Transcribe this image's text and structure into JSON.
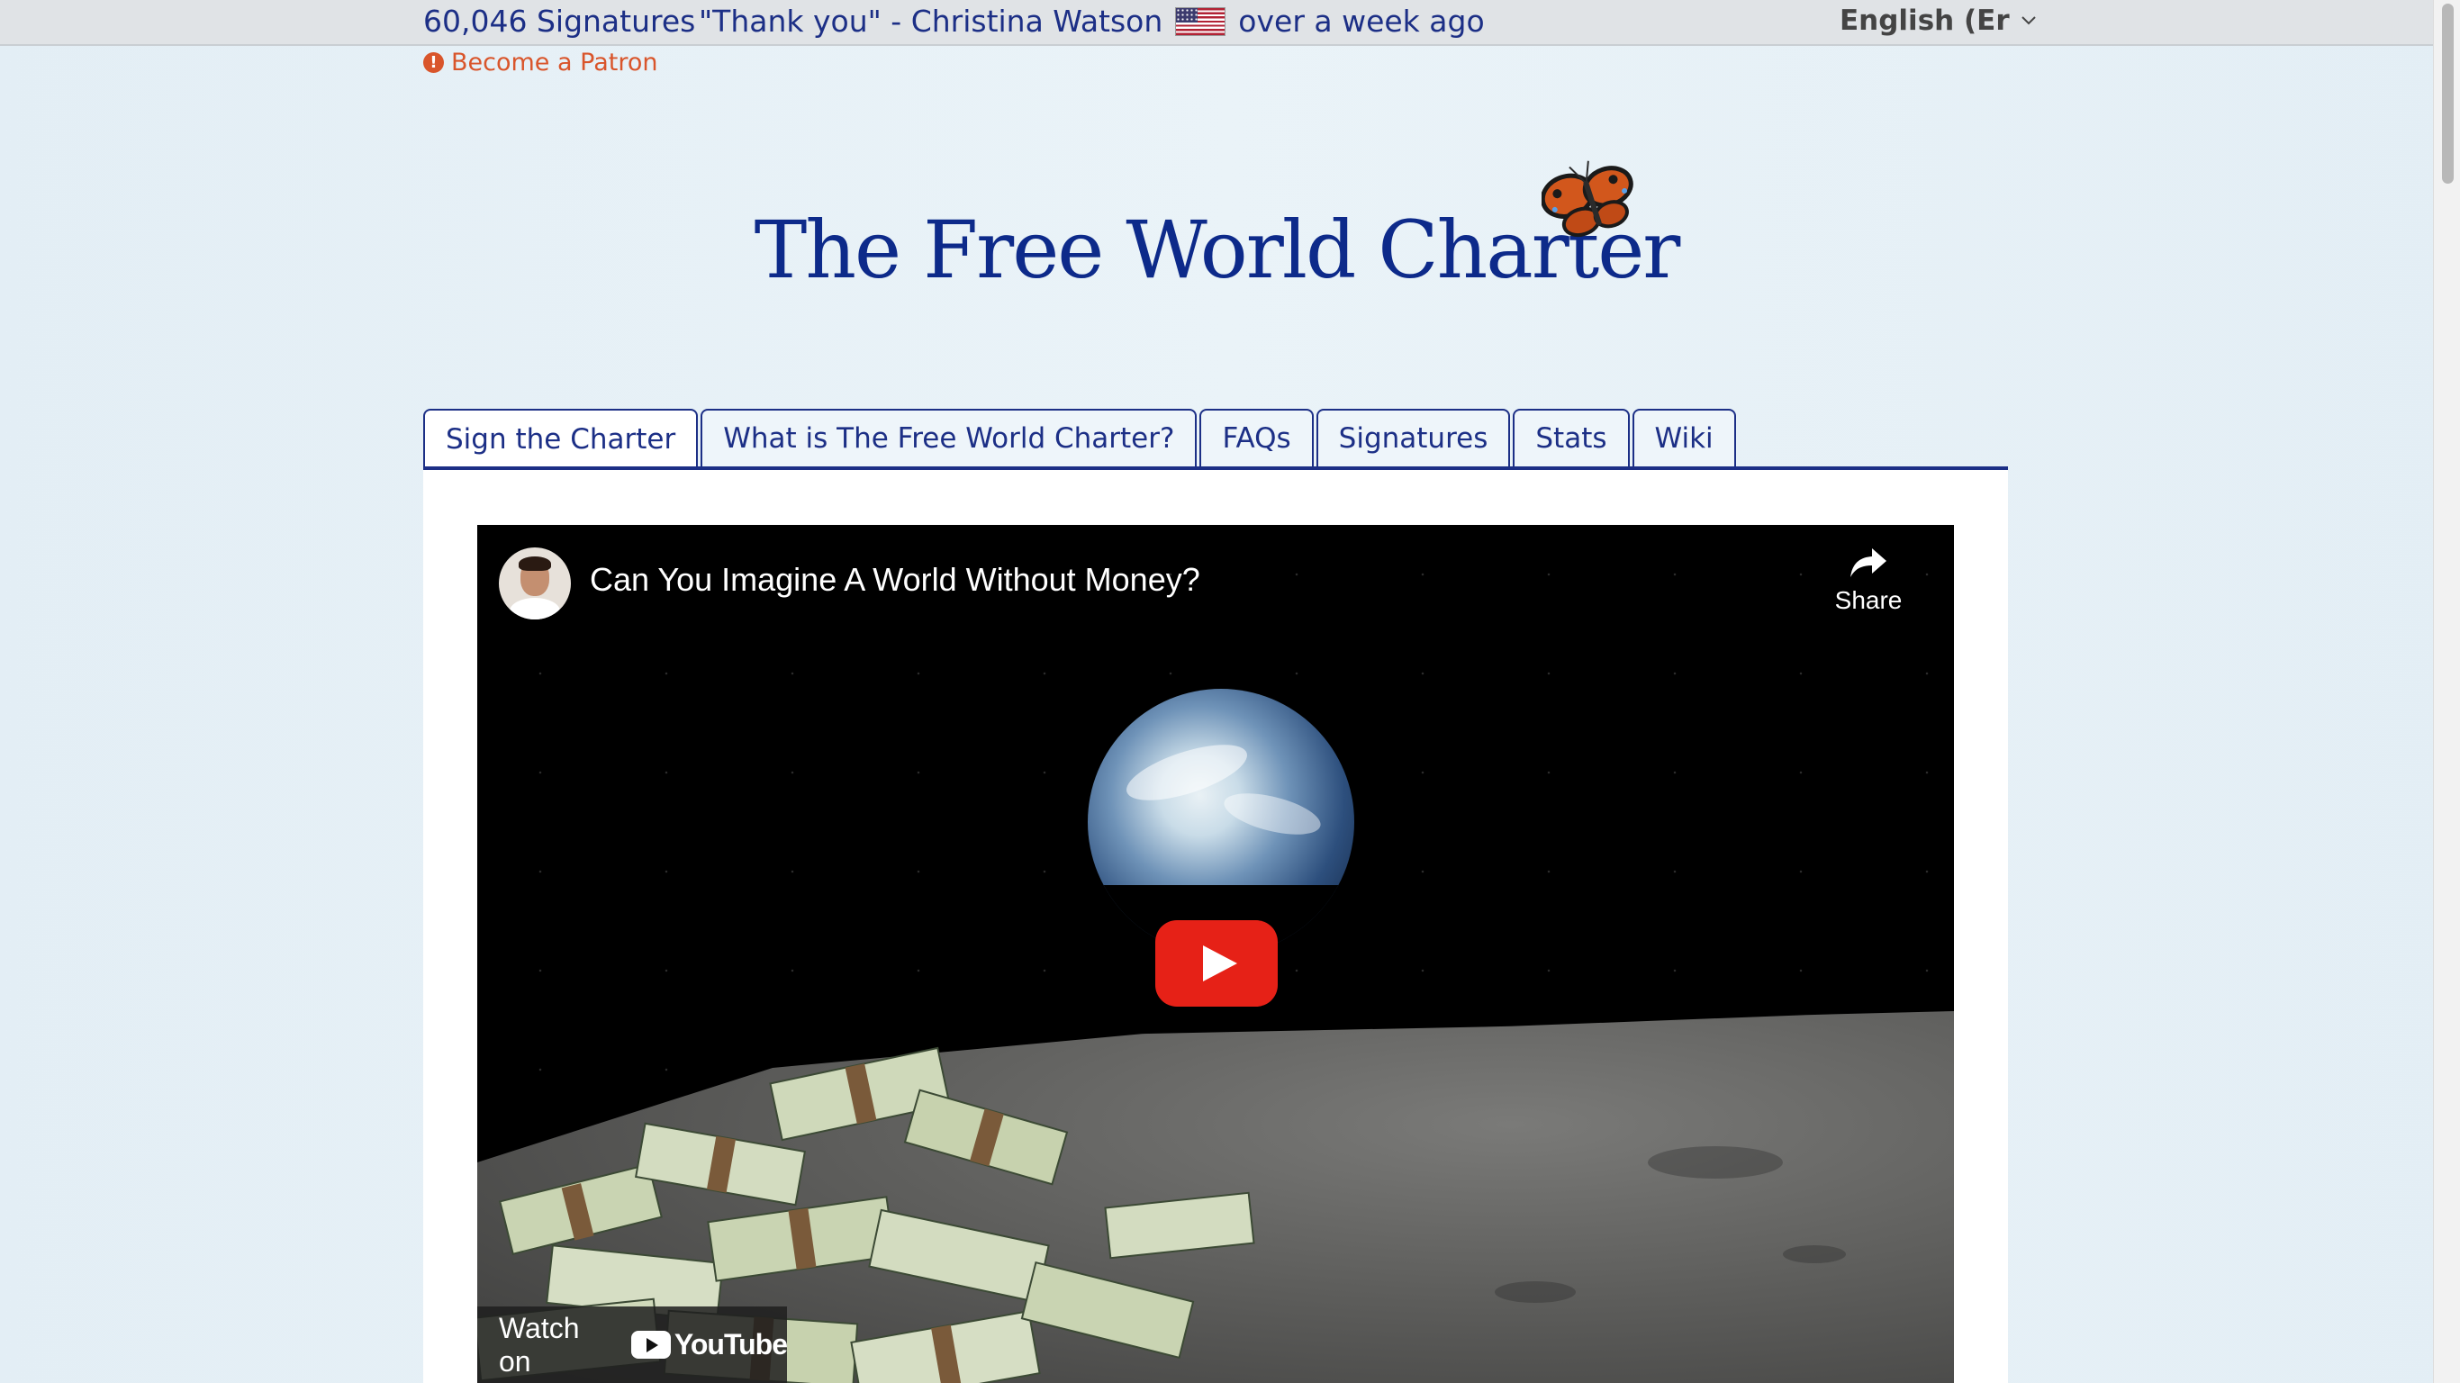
{
  "topbar": {
    "signature_count": "60,046 Signatures",
    "latest_quote": "\"Thank you\" - Christina Watson",
    "latest_time": "over a week ago",
    "language": "English (Er"
  },
  "patron_link": "Become a Patron",
  "site_title": "The Free World Charter",
  "tabs": [
    {
      "label": "Sign the Charter",
      "active": true
    },
    {
      "label": "What is The Free World Charter?"
    },
    {
      "label": "FAQs"
    },
    {
      "label": "Signatures"
    },
    {
      "label": "Stats"
    },
    {
      "label": "Wiki"
    }
  ],
  "video": {
    "title": "Can You Imagine A World Without Money?",
    "share_label": "Share",
    "watch_on": "Watch on",
    "youtube_label": "YouTube"
  },
  "colors": {
    "brand_blue": "#1c2f86",
    "patron_orange": "#d9552b",
    "youtube_red": "#e62117"
  },
  "icons": [
    "us-flag-icon",
    "chevron-down-icon",
    "alert-icon",
    "butterfly-icon",
    "share-icon",
    "play-icon",
    "youtube-logo-icon"
  ]
}
